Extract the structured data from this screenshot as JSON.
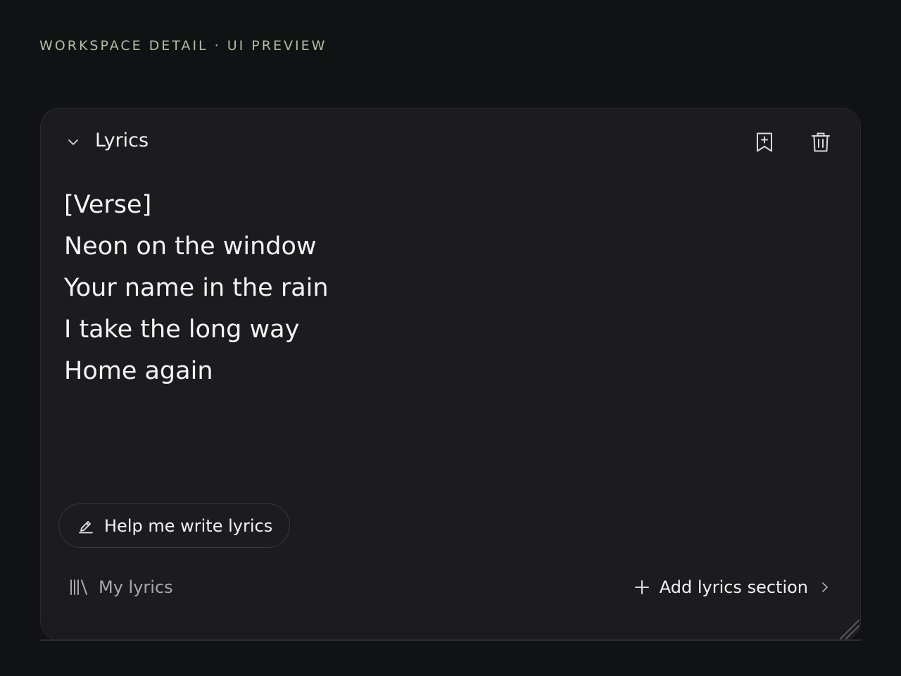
{
  "eyebrow": "WORKSPACE DETAIL · UI PREVIEW",
  "card": {
    "title": "Lyrics",
    "collapse_icon": "chevron-down-icon",
    "actions": [
      {
        "icon": "bookmark-plus-icon"
      },
      {
        "icon": "trash-icon"
      }
    ],
    "lyrics": [
      "[Verse]",
      "Neon on the window",
      "Your name in the rain",
      "I take the long way",
      "Home again"
    ],
    "help_button": {
      "label": "Help me write lyrics",
      "icon": "pen-sparkle-icon"
    },
    "footer": {
      "my_lyrics": {
        "label": "My lyrics",
        "icon": "library-icon"
      },
      "add_section": {
        "label": "Add lyrics section",
        "icon": "plus-icon",
        "chevron": "chevron-right-icon"
      }
    }
  },
  "colors": {
    "background": "#111214",
    "card": "#1c1c1e",
    "eyebrow": "#b7bba3",
    "muted_text": "#a9a9ad"
  }
}
